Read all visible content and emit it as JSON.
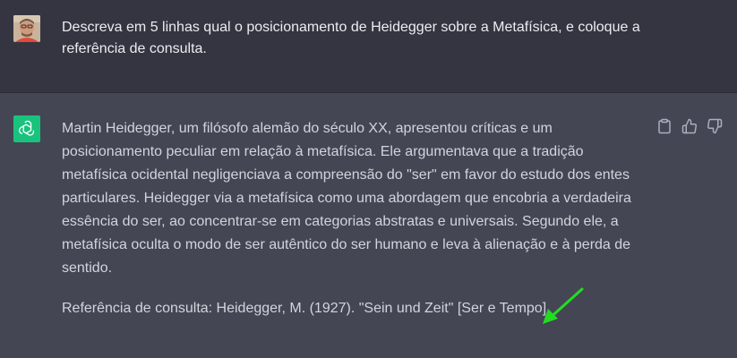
{
  "user_message": {
    "text": "Descreva em 5 linhas qual o posicionamento de Heidegger sobre a Metafísica, e coloque a referência de consulta."
  },
  "assistant_message": {
    "paragraph_1": "Martin Heidegger, um filósofo alemão do século XX, apresentou críticas e um posicionamento peculiar em relação à metafísica. Ele argumentava que a tradição metafísica ocidental negligenciava a compreensão do \"ser\" em favor do estudo dos entes particulares. Heidegger via a metafísica como uma abordagem que encobria a verdadeira essência do ser, ao concentrar-se em categorias abstratas e universais. Segundo ele, a metafísica oculta o modo de ser autêntico do ser humano e leva à alienação e à perda de sentido.",
    "paragraph_2": "Referência de consulta: Heidegger, M. (1927). \"Sein und Zeit\" [Ser e Tempo]."
  },
  "actions": {
    "icons": [
      "clipboard-icon",
      "thumbs-up-icon",
      "thumbs-down-icon"
    ]
  },
  "colors": {
    "user_bg": "#343541",
    "assistant_bg": "#444654",
    "bot_avatar": "#19c37d",
    "annotation_arrow": "#22dd22"
  }
}
